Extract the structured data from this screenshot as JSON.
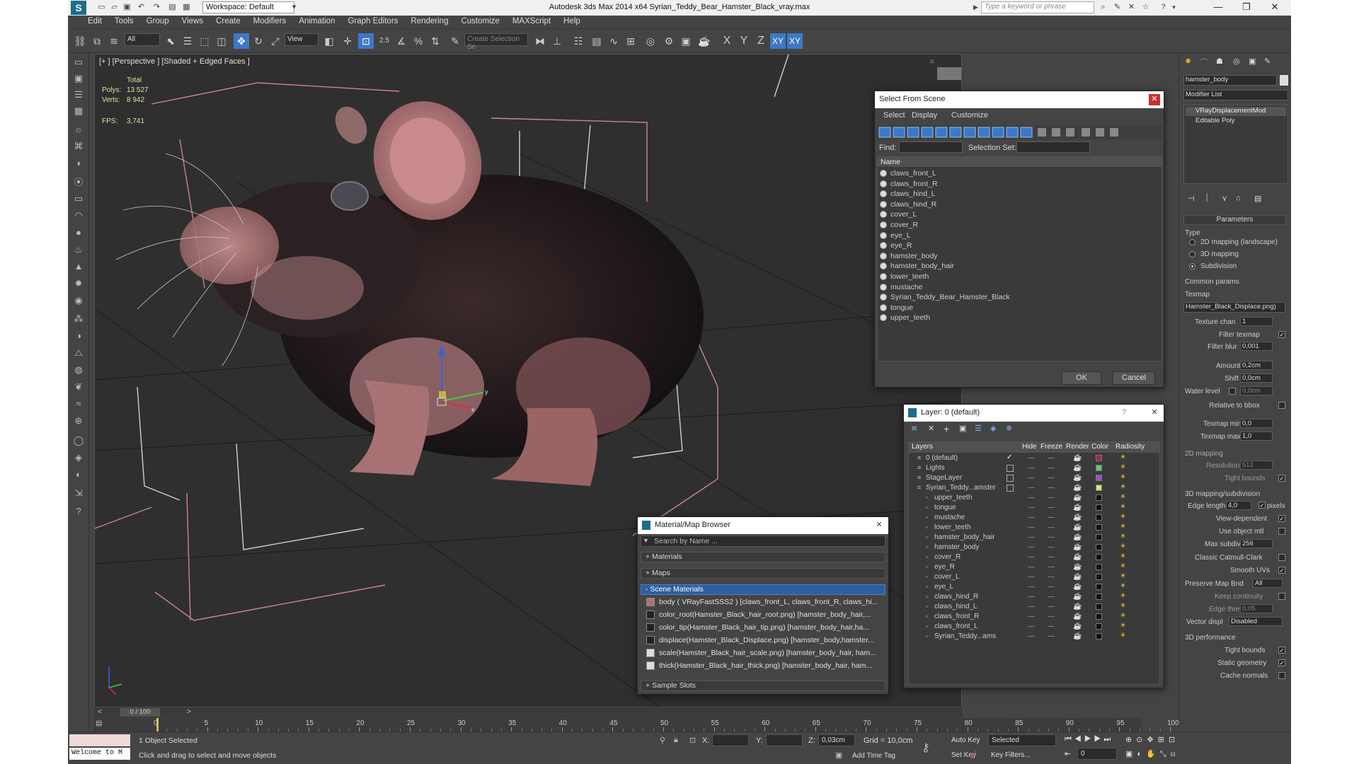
{
  "window": {
    "workspace_label": "Workspace: Default",
    "title": "Autodesk 3ds Max  2014 x64     Syrian_Teddy_Bear_Hamster_Black_vray.max",
    "search_placeholder": "Type a keyword or phrase"
  },
  "menu": [
    "Edit",
    "Tools",
    "Group",
    "Views",
    "Create",
    "Modifiers",
    "Animation",
    "Graph Editors",
    "Rendering",
    "Customize",
    "MAXScript",
    "Help"
  ],
  "toolbar": {
    "selection_filter": "All",
    "ref_coord": "View",
    "named_selection_placeholder": "Create Selection Se",
    "axis_x": "X",
    "axis_y": "Y",
    "axis_z": "Z",
    "axis_xy": "XY",
    "axis_xy2": "XY",
    "snap_label": "2.5"
  },
  "viewport": {
    "label": "[+ ] [Perspective ] [Shaded + Edged Faces ]",
    "stats_total": "Total",
    "polys_label": "Polys:",
    "polys_value": "13 527",
    "verts_label": "Verts:",
    "verts_value": "8 942",
    "fps_label": "FPS:",
    "fps_value": "3,741"
  },
  "select_from_scene": {
    "title": "Select From Scene",
    "tabs": [
      "Select",
      "Display",
      "Customize"
    ],
    "find_label": "Find:",
    "selection_set_label": "Selection Set:",
    "column_name": "Name",
    "items": [
      "claws_front_L",
      "claws_front_R",
      "claws_hind_L",
      "claws_hind_R",
      "cover_L",
      "cover_R",
      "eye_L",
      "eye_R",
      "hamster_body",
      "hamster_body_hair",
      "lower_teeth",
      "mustache",
      "Syrian_Teddy_Bear_Hamster_Black",
      "tongue",
      "upper_teeth"
    ],
    "ok": "OK",
    "cancel": "Cancel"
  },
  "layer_dialog": {
    "title": "Layer: 0 (default)",
    "help": "?",
    "columns": [
      "Layers",
      "Hide",
      "Freeze",
      "Render",
      "Color",
      "Radiosity"
    ],
    "rows": [
      {
        "name": "0 (default)",
        "indent": 0,
        "color": "#b0205a",
        "check": "✓"
      },
      {
        "name": "Lights",
        "indent": 0,
        "color": "#5ac86e",
        "check": ""
      },
      {
        "name": "StageLayer",
        "indent": 0,
        "color": "#a050c8",
        "check": ""
      },
      {
        "name": "Syrian_Teddy...amster",
        "indent": 0,
        "color": "#e0e070",
        "check": ""
      },
      {
        "name": "upper_teeth",
        "indent": 1,
        "color": "#111111",
        "check": ""
      },
      {
        "name": "tongue",
        "indent": 1,
        "color": "#111111",
        "check": ""
      },
      {
        "name": "mustache",
        "indent": 1,
        "color": "#111111",
        "check": ""
      },
      {
        "name": "lower_teeth",
        "indent": 1,
        "color": "#111111",
        "check": ""
      },
      {
        "name": "hamster_body_hair",
        "indent": 1,
        "color": "#111111",
        "check": ""
      },
      {
        "name": "hamster_body",
        "indent": 1,
        "color": "#111111",
        "check": ""
      },
      {
        "name": "cover_R",
        "indent": 1,
        "color": "#111111",
        "check": ""
      },
      {
        "name": "eye_R",
        "indent": 1,
        "color": "#111111",
        "check": ""
      },
      {
        "name": "cover_L",
        "indent": 1,
        "color": "#111111",
        "check": ""
      },
      {
        "name": "eye_L",
        "indent": 1,
        "color": "#111111",
        "check": ""
      },
      {
        "name": "claws_hind_R",
        "indent": 1,
        "color": "#111111",
        "check": ""
      },
      {
        "name": "claws_hind_L",
        "indent": 1,
        "color": "#111111",
        "check": ""
      },
      {
        "name": "claws_front_R",
        "indent": 1,
        "color": "#111111",
        "check": ""
      },
      {
        "name": "claws_front_L",
        "indent": 1,
        "color": "#111111",
        "check": ""
      },
      {
        "name": "Syrian_Teddy...ams",
        "indent": 1,
        "color": "#111111",
        "check": ""
      }
    ]
  },
  "material_browser": {
    "title": "Material/Map Browser",
    "search_placeholder": "Search by Name ...",
    "sections": {
      "materials": "+ Materials",
      "maps": "+ Maps",
      "scene": "- Scene Materials",
      "samples": "+ Sample Slots"
    },
    "scene_items": [
      "body  ( VRayFastSSS2 ) [claws_front_L, claws_front_R, claws_hi...",
      "color_root(Hamster_Black_hair_root.png) [hamster_body_hair,...",
      "color_tip(Hamster_Black_hair_tip.png) [hamster_body_hair,ha...",
      "displace(Hamster_Black_Displace.png) [hamster_body,hamster...",
      "scale(Hamster_Black_hair_scale.png) [hamster_body_hair, ham...",
      "thick(Hamster_Black_hair_thick.png) [hamster_body_hair, ham..."
    ]
  },
  "command_panel": {
    "object_name": "hamster_body",
    "modifier_list": "Modifier List",
    "stack": [
      "VRayDisplacementMod",
      "Editable Poly"
    ],
    "parameters": "Parameters",
    "type_label": "Type",
    "type_options": [
      "2D mapping (landscape)",
      "3D mapping",
      "Subdivision"
    ],
    "common_params": "Common params",
    "texmap_label": "Texmap",
    "texmap_value": "Hamster_Black_Displace.png)",
    "texture_chan_label": "Texture chan",
    "texture_chan_value": "1",
    "filter_texmap": "Filter texmap",
    "filter_blur_label": "Filter blur",
    "filter_blur_value": "0,001",
    "amount_label": "Amount",
    "amount_value": "0,2cm",
    "shift_label": "Shift",
    "shift_value": "0,0cm",
    "water_level_label": "Water level",
    "water_level_value": "0,0cm",
    "relative_bbox": "Relative to bbox",
    "texmap_min_label": "Texmap min",
    "texmap_min_value": "0,0",
    "texmap_max_label": "Texmap max",
    "texmap_max_value": "1,0",
    "mapping2d": "2D mapping",
    "resolution_label": "Resolution",
    "resolution_value": "512",
    "tight_bounds": "Tight bounds",
    "mapping3d": "3D mapping/subdivision",
    "edge_length_label": "Edge length",
    "edge_length_value": "4,0",
    "pixels": "pixels",
    "view_dependent": "View-dependent",
    "use_object_mtl": "Use object mtl",
    "max_subdivs_label": "Max subdivs",
    "max_subdivs_value": "256",
    "classic_catmull": "Classic Catmull-Clark",
    "smooth_uvs": "Smooth UVs",
    "preserve_map_label": "Preserve Map Bnd",
    "preserve_map_value": "All",
    "keep_continuity": "Keep continuity",
    "edge_thresh_label": "Edge thresh",
    "edge_thresh_value": "0,05",
    "vector_displ_label": "Vector displ",
    "vector_displ_value": "Disabled",
    "perf_label": "3D performance",
    "perf_tight": "Tight bounds",
    "perf_static": "Static geometry",
    "perf_cache": "Cache normals"
  },
  "timeline": {
    "frame_counter": "0 / 100",
    "ticks": [
      "0",
      "5",
      "10",
      "15",
      "20",
      "25",
      "30",
      "35",
      "40",
      "45",
      "50",
      "55",
      "60",
      "65",
      "70",
      "75",
      "80",
      "85",
      "90",
      "95",
      "100"
    ]
  },
  "status": {
    "maxscript": "Welcome to M",
    "selected": "1 Object Selected",
    "prompt": "Click and drag to select and move objects",
    "x_label": "X:",
    "y_label": "Y:",
    "z_label": "Z:",
    "z_value": "0,03cm",
    "grid": "Grid = 10,0cm",
    "add_time_tag": "Add Time Tag",
    "auto_key": "Auto Key",
    "set_key": "Set Key",
    "selected_set": "Selected",
    "key_filters": "Key Filters...",
    "frame": "0"
  }
}
